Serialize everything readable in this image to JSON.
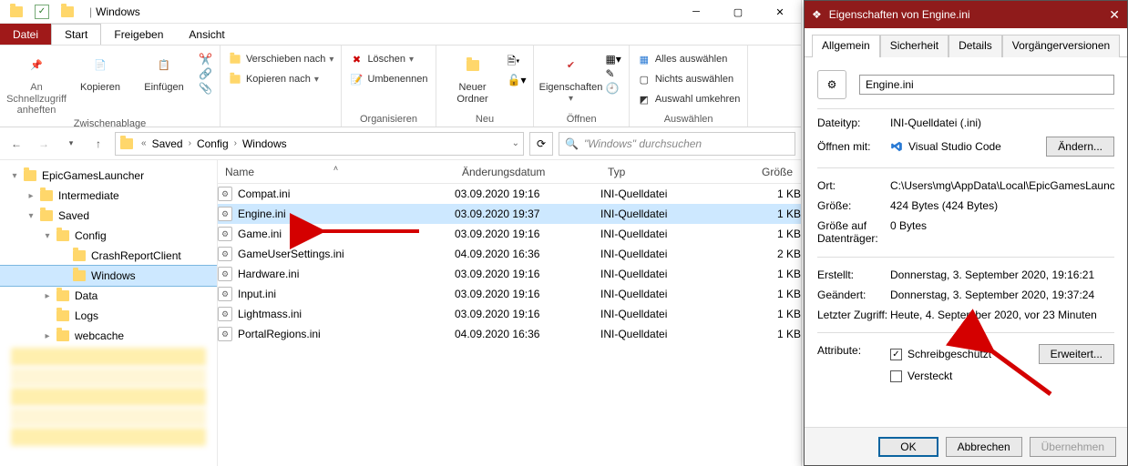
{
  "window": {
    "title": "Windows"
  },
  "quick": {
    "save": "",
    "undo": ""
  },
  "menus": {
    "file": "Datei",
    "start": "Start",
    "share": "Freigeben",
    "view": "Ansicht"
  },
  "ribbon": {
    "pin": "An Schnellzugriff anheften",
    "copy": "Kopieren",
    "paste": "Einfügen",
    "move": "Verschieben nach",
    "copyto": "Kopieren nach",
    "delete": "Löschen",
    "rename": "Umbenennen",
    "newfolder": "Neuer Ordner",
    "properties": "Eigenschaften",
    "selectall": "Alles auswählen",
    "selectnone": "Nichts auswählen",
    "invert": "Auswahl umkehren",
    "grp_clip": "Zwischenablage",
    "grp_org": "Organisieren",
    "grp_new": "Neu",
    "grp_open": "Öffnen",
    "grp_sel": "Auswählen"
  },
  "address": {
    "crumbs": [
      "Saved",
      "Config",
      "Windows"
    ]
  },
  "search": {
    "placeholder": "\"Windows\" durchsuchen"
  },
  "tree": [
    {
      "label": "EpicGamesLauncher",
      "depth": 0,
      "twist": "▾"
    },
    {
      "label": "Intermediate",
      "depth": 1,
      "twist": "▸"
    },
    {
      "label": "Saved",
      "depth": 1,
      "twist": "▾"
    },
    {
      "label": "Config",
      "depth": 2,
      "twist": "▾"
    },
    {
      "label": "CrashReportClient",
      "depth": 3,
      "twist": ""
    },
    {
      "label": "Windows",
      "depth": 3,
      "twist": "",
      "selected": true
    },
    {
      "label": "Data",
      "depth": 2,
      "twist": "▸"
    },
    {
      "label": "Logs",
      "depth": 2,
      "twist": ""
    },
    {
      "label": "webcache",
      "depth": 2,
      "twist": "▸"
    }
  ],
  "columns": {
    "name": "Name",
    "date": "Änderungsdatum",
    "type": "Typ",
    "size": "Größe"
  },
  "files": [
    {
      "name": "Compat.ini",
      "date": "03.09.2020 19:16",
      "type": "INI-Quelldatei",
      "size": "1 KB"
    },
    {
      "name": "Engine.ini",
      "date": "03.09.2020 19:37",
      "type": "INI-Quelldatei",
      "size": "1 KB",
      "selected": true
    },
    {
      "name": "Game.ini",
      "date": "03.09.2020 19:16",
      "type": "INI-Quelldatei",
      "size": "1 KB"
    },
    {
      "name": "GameUserSettings.ini",
      "date": "04.09.2020 16:36",
      "type": "INI-Quelldatei",
      "size": "2 KB"
    },
    {
      "name": "Hardware.ini",
      "date": "03.09.2020 19:16",
      "type": "INI-Quelldatei",
      "size": "1 KB"
    },
    {
      "name": "Input.ini",
      "date": "03.09.2020 19:16",
      "type": "INI-Quelldatei",
      "size": "1 KB"
    },
    {
      "name": "Lightmass.ini",
      "date": "03.09.2020 19:16",
      "type": "INI-Quelldatei",
      "size": "1 KB"
    },
    {
      "name": "PortalRegions.ini",
      "date": "04.09.2020 16:36",
      "type": "INI-Quelldatei",
      "size": "1 KB"
    }
  ],
  "props": {
    "title": "Eigenschaften von Engine.ini",
    "tabs": {
      "general": "Allgemein",
      "security": "Sicherheit",
      "details": "Details",
      "prev": "Vorgängerversionen"
    },
    "filename": "Engine.ini",
    "rows": {
      "type_l": "Dateityp:",
      "type_v": "INI-Quelldatei (.ini)",
      "open_l": "Öffnen mit:",
      "open_v": "Visual Studio Code",
      "change": "Ändern...",
      "loc_l": "Ort:",
      "loc_v": "C:\\Users\\mg\\AppData\\Local\\EpicGamesLauncher\\",
      "size_l": "Größe:",
      "size_v": "424 Bytes (424 Bytes)",
      "disk_l": "Größe auf Datenträger:",
      "disk_v": "0 Bytes",
      "created_l": "Erstellt:",
      "created_v": "Donnerstag, 3. September 2020, 19:16:21",
      "modified_l": "Geändert:",
      "modified_v": "Donnerstag, 3. September 2020, 19:37:24",
      "access_l": "Letzter Zugriff:",
      "access_v": "Heute, 4. September 2020, vor 23 Minuten",
      "attr_l": "Attribute:",
      "readonly": "Schreibgeschützt",
      "hidden": "Versteckt",
      "advanced": "Erweitert..."
    },
    "buttons": {
      "ok": "OK",
      "cancel": "Abbrechen",
      "apply": "Übernehmen"
    }
  }
}
